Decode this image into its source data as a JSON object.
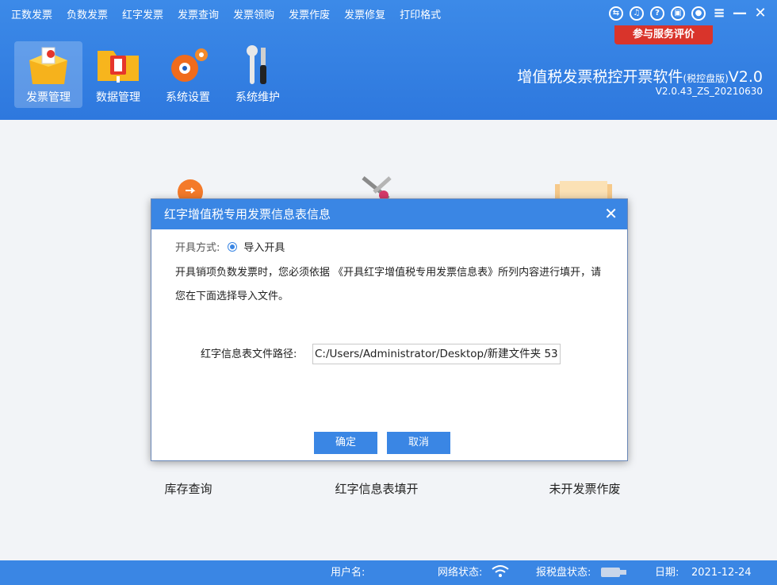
{
  "menu": [
    "正数发票",
    "负数发票",
    "红字发票",
    "发票查询",
    "发票领购",
    "发票作废",
    "发票修复",
    "打印格式"
  ],
  "top_icons": [
    "transfer-icon",
    "headset-icon",
    "help-icon",
    "lock-icon",
    "user-icon",
    "menu-icon",
    "minimize-icon",
    "close-icon"
  ],
  "eval_button": "参与服务评价",
  "tools": [
    {
      "label": "发票管理",
      "icon": "invoice-box-icon"
    },
    {
      "label": "数据管理",
      "icon": "folder-icon"
    },
    {
      "label": "系统设置",
      "icon": "gear-icon"
    },
    {
      "label": "系统维护",
      "icon": "tools-icon"
    }
  ],
  "app": {
    "title": "增值税发票税控开票软件",
    "title_suffix": "(税控盘版)",
    "title_version": "V2.0",
    "version": "V2.0.43_ZS_20210630"
  },
  "tiles": [
    "库存查询",
    "红字信息表填开",
    "未开发票作废"
  ],
  "dialog": {
    "title": "红字增值税专用发票信息表信息",
    "mode_label": "开具方式:",
    "mode_option": "导入开具",
    "description": "开具销项负数发票时，您必须依据 《开具红字增值税专用发票信息表》所列内容进行填开，请您在下面选择导入文件。",
    "path_label": "红字信息表文件路径:",
    "path_value": "C:/Users/Administrator/Desktop/新建文件夹 53",
    "ok": "确定",
    "cancel": "取消"
  },
  "status": {
    "user_label": "用户名:",
    "user_value": "",
    "network_label": "网络状态:",
    "disk_label": "报税盘状态:",
    "date_label": "日期:",
    "date_value": "2021-12-24"
  },
  "colors": {
    "primary": "#3a86e4",
    "eval": "#d9342b"
  }
}
